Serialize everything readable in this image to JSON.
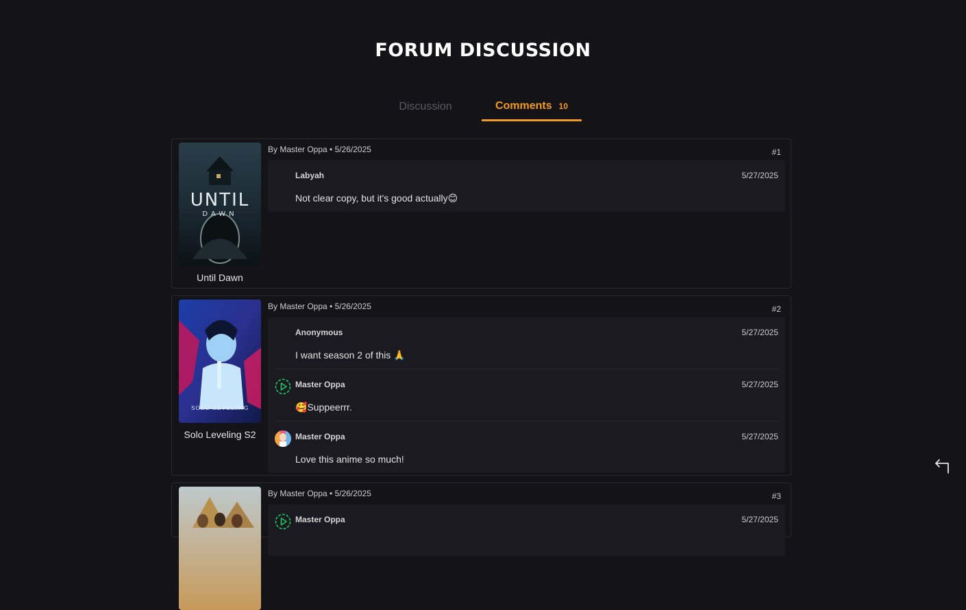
{
  "page": {
    "title": "FORUM DISCUSSION"
  },
  "tabs": {
    "discussion_label": "Discussion",
    "comments_label": "Comments",
    "comments_count": "10"
  },
  "posts": [
    {
      "poster_title": "Until Dawn",
      "poster_text_main": "UNTIL",
      "poster_text_sub": "DAWN",
      "meta": "By Master Oppa • 5/26/2025",
      "index": "#1",
      "comments": [
        {
          "author": "Labyah",
          "date": "5/27/2025",
          "text": "Not clear copy, but it's good actually😊",
          "avatar": "none"
        }
      ]
    },
    {
      "poster_title": "Solo Leveling S2",
      "poster_text_main": "SOLO LEVELING",
      "meta": "By Master Oppa • 5/26/2025",
      "index": "#2",
      "comments": [
        {
          "author": "Anonymous",
          "date": "5/27/2025",
          "text": "I want season 2 of this 🙏",
          "avatar": "none"
        },
        {
          "author": "Master Oppa",
          "date": "5/27/2025",
          "text": "🥰Suppeerrr.",
          "avatar": "play-circle-icon"
        },
        {
          "author": "Master Oppa",
          "date": "5/27/2025",
          "text": "Love this anime so much!",
          "avatar": "profile-photo"
        }
      ]
    },
    {
      "meta": "By Master Oppa • 5/26/2025",
      "index": "#3",
      "comments": [
        {
          "author": "Master Oppa",
          "date": "5/27/2025",
          "avatar": "play-circle-icon"
        }
      ]
    }
  ],
  "icons": {
    "back": "return-arrow-icon"
  },
  "colors": {
    "background": "#131318",
    "accent": "#f39c1d",
    "card_border": "#2a2a31",
    "comment_bg": "#1a1a20",
    "play_icon": "#22c55e"
  }
}
